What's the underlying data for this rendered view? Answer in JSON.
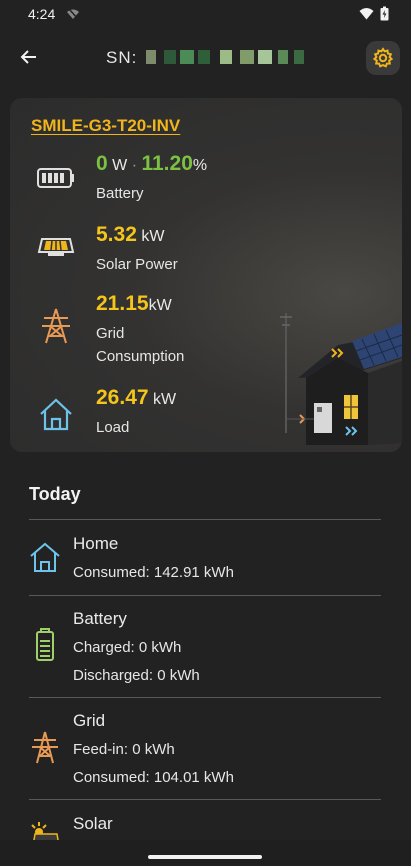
{
  "status": {
    "time": "4:24"
  },
  "header": {
    "sn_label": "SN:"
  },
  "device": {
    "name": "SMILE-G3-T20-INV",
    "battery": {
      "power": "0",
      "power_unit": "W",
      "separator": "·",
      "soc": "11.20",
      "soc_unit": "%",
      "label": "Battery"
    },
    "solar": {
      "value": "5.32",
      "unit": "kW",
      "label": "Solar Power"
    },
    "grid": {
      "value": "21.15",
      "unit": "kW",
      "label_line1": "Grid",
      "label_line2": "Consumption"
    },
    "load": {
      "value": "26.47",
      "unit": "kW",
      "label": "Load"
    }
  },
  "today": {
    "title": "Today",
    "home": {
      "title": "Home",
      "consumed": "Consumed: 142.91 kWh"
    },
    "battery": {
      "title": "Battery",
      "charged": "Charged: 0 kWh",
      "discharged": "Discharged: 0 kWh"
    },
    "grid": {
      "title": "Grid",
      "feed_in": "Feed-in: 0 kWh",
      "consumed": "Consumed: 104.01 kWh"
    },
    "solar": {
      "title": "Solar"
    }
  },
  "colors": {
    "accent": "#f1b51c",
    "green": "#7cc142",
    "background": "#222222",
    "home_icon": "#6ec3ea",
    "battery_icon": "#9fd06a",
    "grid_icon": "#e89a55"
  }
}
